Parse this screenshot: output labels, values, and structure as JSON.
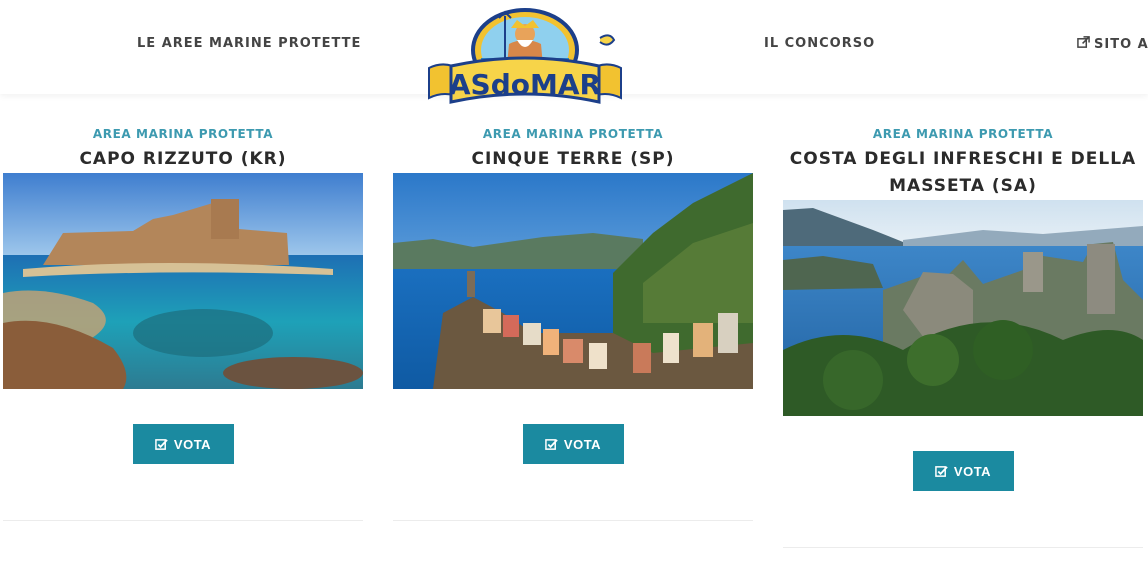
{
  "nav": {
    "left_label": "LE AREE MARINE PROTETTE",
    "center_label": "IL CONCORSO",
    "right_label": "SITO AS"
  },
  "logo": {
    "text": "ASdoMAR"
  },
  "cards": [
    {
      "kicker": "AREA MARINA PROTETTA",
      "title": "CAPO RIZZUTO (KR)",
      "button_label": "VOTA"
    },
    {
      "kicker": "AREA MARINA PROTETTA",
      "title": "CINQUE TERRE (SP)",
      "button_label": "VOTA"
    },
    {
      "kicker": "AREA MARINA PROTETTA",
      "title": "COSTA DEGLI INFRESCHI E DELLA MASSETA (SA)",
      "button_label": "VOTA"
    }
  ],
  "colors": {
    "accent": "#1b8aa0",
    "kicker": "#3d9ab0",
    "title": "#2b2b2b"
  },
  "icons": {
    "vote": "check-square-icon",
    "external": "external-link-icon"
  }
}
